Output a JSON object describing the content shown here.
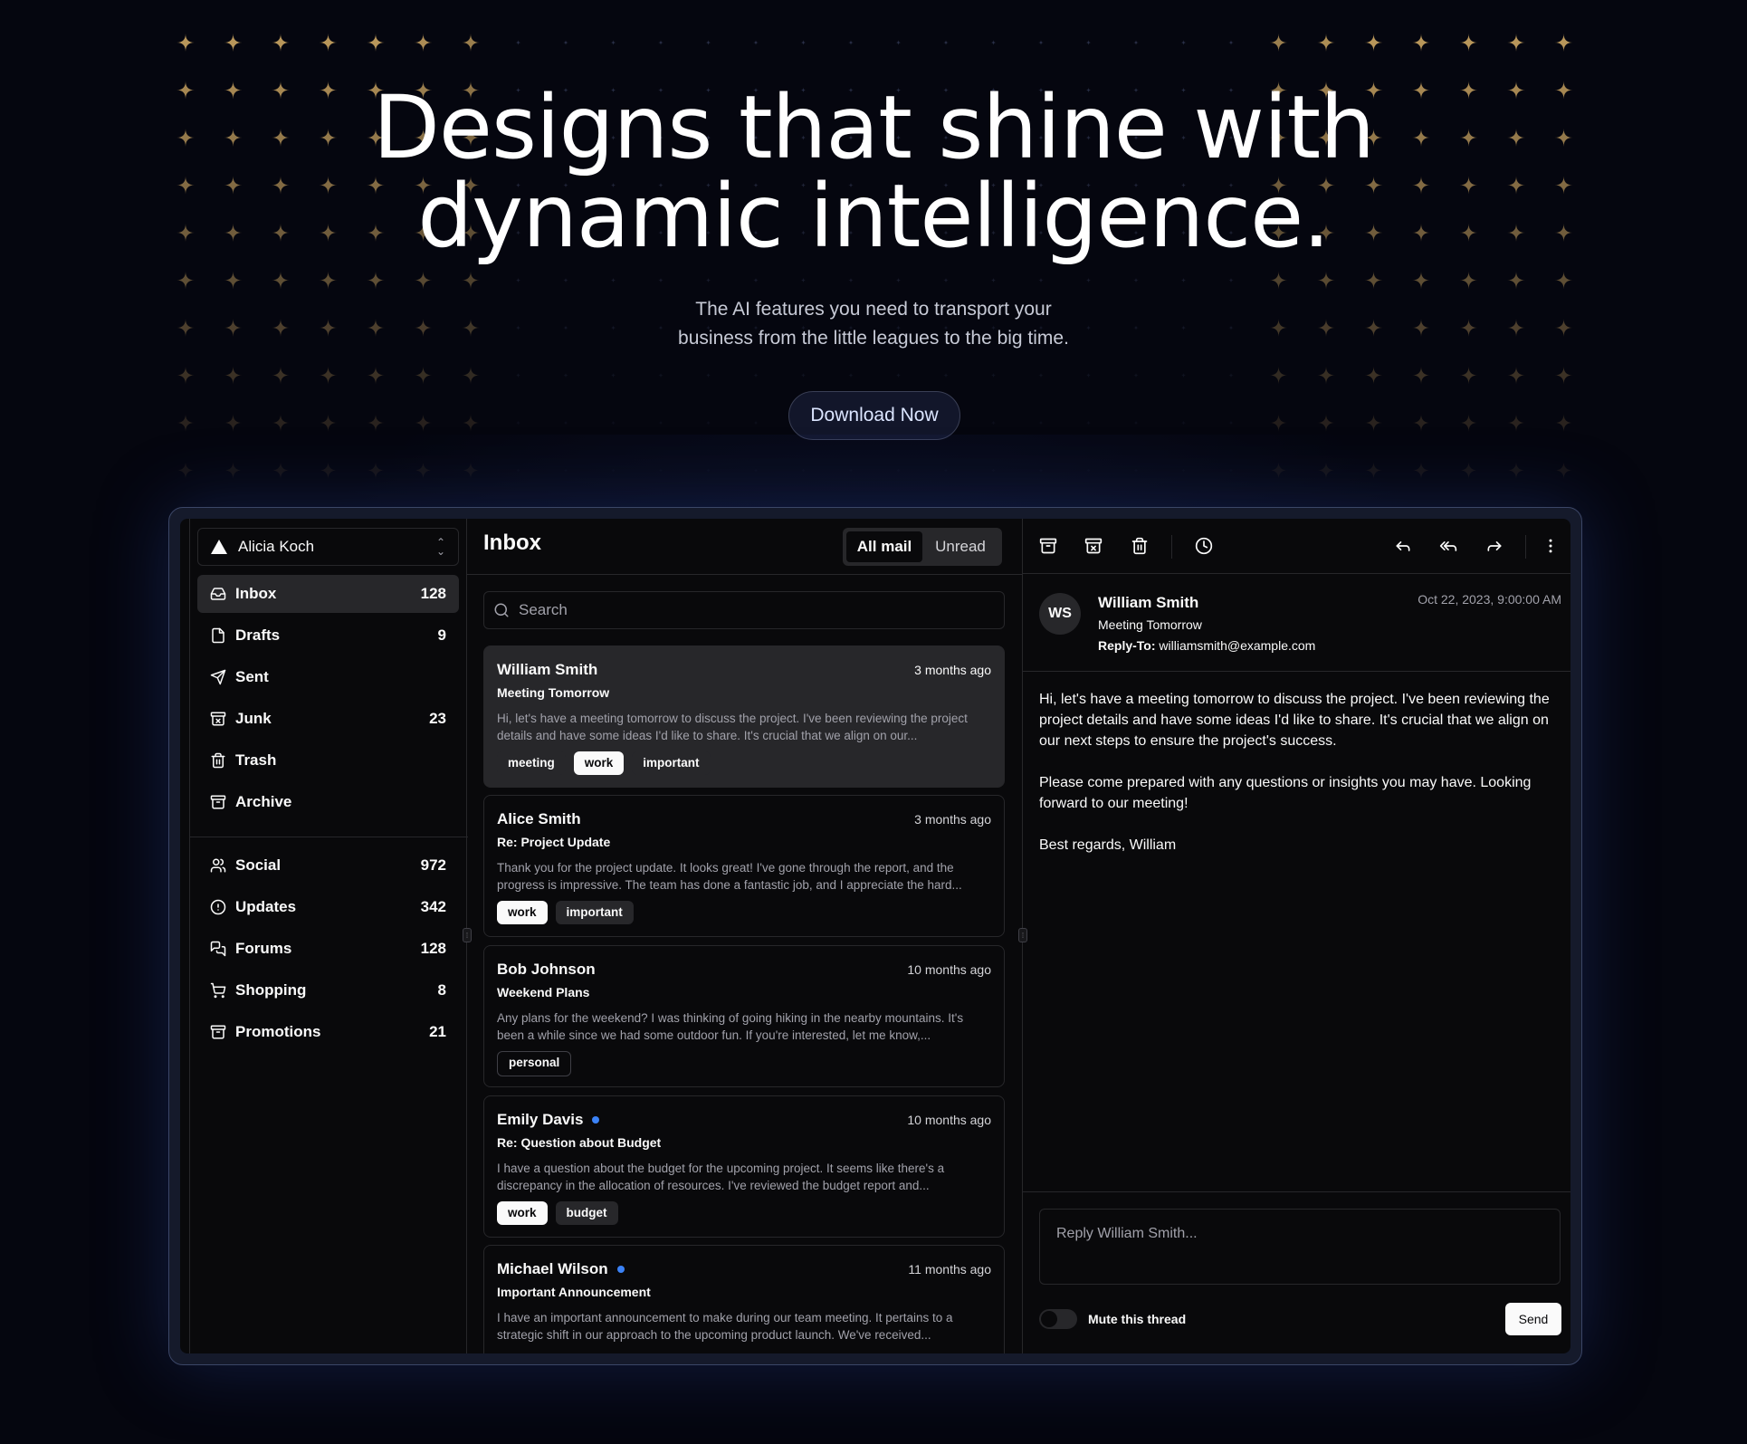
{
  "hero": {
    "title_line1": "Designs that shine with",
    "title_line2": "dynamic intelligence.",
    "subtitle_line1": "The AI features you need to transport your",
    "subtitle_line2": "business from the little leagues to the big time.",
    "cta_label": "Download Now"
  },
  "account": {
    "name": "Alicia Koch"
  },
  "nav_primary": [
    {
      "label": "Inbox",
      "count": "128",
      "icon": "inbox-icon"
    },
    {
      "label": "Drafts",
      "count": "9",
      "icon": "file-icon"
    },
    {
      "label": "Sent",
      "count": "",
      "icon": "send-icon"
    },
    {
      "label": "Junk",
      "count": "23",
      "icon": "archive-x-icon"
    },
    {
      "label": "Trash",
      "count": "",
      "icon": "trash-icon"
    },
    {
      "label": "Archive",
      "count": "",
      "icon": "archive-icon"
    }
  ],
  "nav_secondary": [
    {
      "label": "Social",
      "count": "972",
      "icon": "users-icon"
    },
    {
      "label": "Updates",
      "count": "342",
      "icon": "alert-circle-icon"
    },
    {
      "label": "Forums",
      "count": "128",
      "icon": "messages-icon"
    },
    {
      "label": "Shopping",
      "count": "8",
      "icon": "cart-icon"
    },
    {
      "label": "Promotions",
      "count": "21",
      "icon": "archive-icon"
    }
  ],
  "list": {
    "title": "Inbox",
    "filter_all": "All mail",
    "filter_unread": "Unread",
    "search_placeholder": "Search",
    "mails": [
      {
        "from": "William Smith",
        "when": "3 months ago",
        "subject": "Meeting Tomorrow",
        "preview": "Hi, let's have a meeting tomorrow to discuss the project. I've been reviewing the project details and have some ideas I'd like to share. It's crucial that we align on our...",
        "unread": false,
        "tags": [
          {
            "label": "meeting",
            "style": "dark"
          },
          {
            "label": "work",
            "style": "light"
          },
          {
            "label": "important",
            "style": "dark"
          }
        ]
      },
      {
        "from": "Alice Smith",
        "when": "3 months ago",
        "subject": "Re: Project Update",
        "preview": "Thank you for the project update. It looks great! I've gone through the report, and the progress is impressive. The team has done a fantastic job, and I appreciate the hard...",
        "unread": false,
        "tags": [
          {
            "label": "work",
            "style": "light"
          },
          {
            "label": "important",
            "style": "dark"
          }
        ]
      },
      {
        "from": "Bob Johnson",
        "when": "10 months ago",
        "subject": "Weekend Plans",
        "preview": "Any plans for the weekend? I was thinking of going hiking in the nearby mountains. It's been a while since we had some outdoor fun. If you're interested, let me know,...",
        "unread": false,
        "tags": [
          {
            "label": "personal",
            "style": "outline"
          }
        ]
      },
      {
        "from": "Emily Davis",
        "when": "10 months ago",
        "subject": "Re: Question about Budget",
        "preview": "I have a question about the budget for the upcoming project. It seems like there's a discrepancy in the allocation of resources. I've reviewed the budget report and...",
        "unread": true,
        "tags": [
          {
            "label": "work",
            "style": "light"
          },
          {
            "label": "budget",
            "style": "dark"
          }
        ]
      },
      {
        "from": "Michael Wilson",
        "when": "11 months ago",
        "subject": "Important Announcement",
        "preview": "I have an important announcement to make during our team meeting. It pertains to a strategic shift in our approach to the upcoming product launch. We've received...",
        "unread": true,
        "tags": []
      }
    ]
  },
  "detail": {
    "initials": "WS",
    "from": "William Smith",
    "subject": "Meeting Tomorrow",
    "reply_to_label": "Reply-To:",
    "reply_to": "williamsmith@example.com",
    "date": "Oct 22, 2023, 9:00:00 AM",
    "body_p1": "Hi, let's have a meeting tomorrow to discuss the project. I've been reviewing the project details and have some ideas I'd like to share. It's crucial that we align on our next steps to ensure the project's success.",
    "body_p2": "Please come prepared with any questions or insights you may have. Looking forward to our meeting!",
    "body_p3": "Best regards, William",
    "reply_placeholder": "Reply William Smith...",
    "mute_label": "Mute this thread",
    "send_label": "Send"
  },
  "colors": {
    "background": "#05060f",
    "panel": "#09090b",
    "border": "#27272a",
    "star": "#b8965a",
    "unread_dot": "#3b82f6"
  }
}
